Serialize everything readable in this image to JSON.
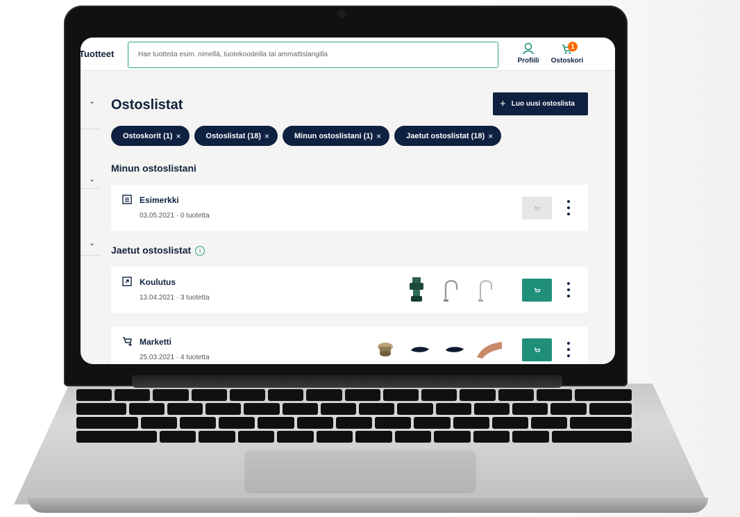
{
  "header": {
    "nav_label": "Tuotteet",
    "search_placeholder": "Hae tuotteita esim. nimellä, tuotekoodeilla tai ammattislangilla",
    "profile_label": "Profiili",
    "cart_label": "Ostoskori",
    "cart_count": "1"
  },
  "page": {
    "title": "Ostoslistat",
    "new_list_button": "Luo uusi ostoslista"
  },
  "filters": [
    {
      "label": "Ostoskorit (1)"
    },
    {
      "label": "Ostoslistat (18)"
    },
    {
      "label": "Minun ostoslistani (1)"
    },
    {
      "label": "Jaetut ostoslistat (18)"
    }
  ],
  "sections": {
    "mine_title": "Minun ostoslistani",
    "shared_title": "Jaetut ostoslistat"
  },
  "lists": [
    {
      "name": "Esimerkki",
      "date": "03.05.2021",
      "count": "0 tuotetta",
      "icon": "list-icon",
      "cart_enabled": false
    },
    {
      "name": "Koulutus",
      "date": "13.04.2021",
      "count": "3 tuotetta",
      "icon": "shared-list-icon",
      "cart_enabled": true,
      "thumbs": [
        "pipe-fitting",
        "faucet",
        "faucet"
      ]
    },
    {
      "name": "Marketti",
      "date": "25.03.2021",
      "count": "4 tuotetta",
      "icon": "shared-cart-icon",
      "cart_enabled": true,
      "thumbs": [
        "brass-nut",
        "black-part",
        "black-part",
        "copper-pipe"
      ]
    }
  ],
  "meta_separator": "·",
  "colors": {
    "navy": "#0f2140",
    "teal": "#1f8f7a",
    "badge": "#ff6a00",
    "background": "#f4f4f2"
  }
}
